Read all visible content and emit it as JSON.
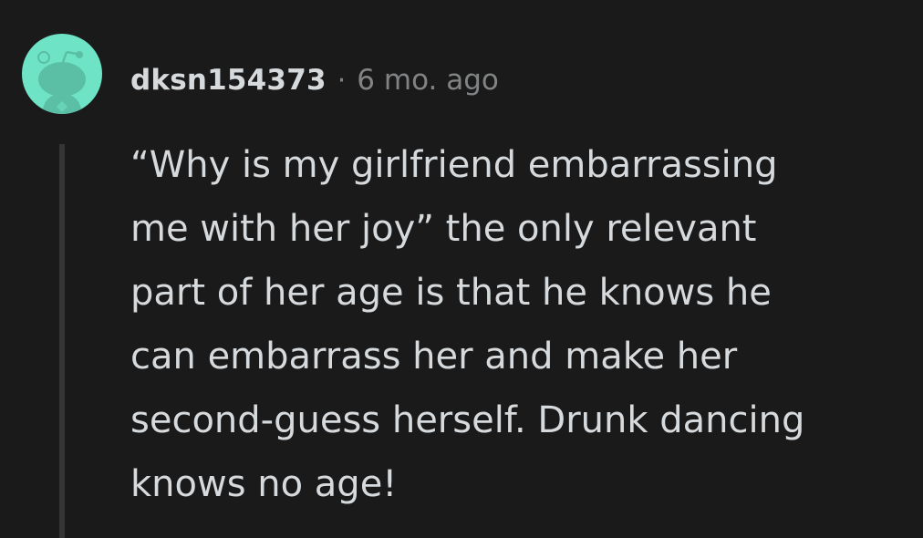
{
  "comment": {
    "username": "dksn154373",
    "separator": "·",
    "timestamp": "6 mo. ago",
    "avatar_icon": "reddit-snoo-avatar-icon",
    "avatar_color": "#6fe3c6",
    "body_lines": [
      "“Why is my girlfriend embarrassing",
      "me with her joy” the only relevant",
      "part of her age is that he knows he",
      "can embarrass her and make her",
      "second-guess herself. Drunk dancing",
      "knows no age!"
    ]
  },
  "colors": {
    "background": "#1a1a1b",
    "text": "#d7dadc",
    "meta": "#818384",
    "thread_line": "#343536"
  }
}
